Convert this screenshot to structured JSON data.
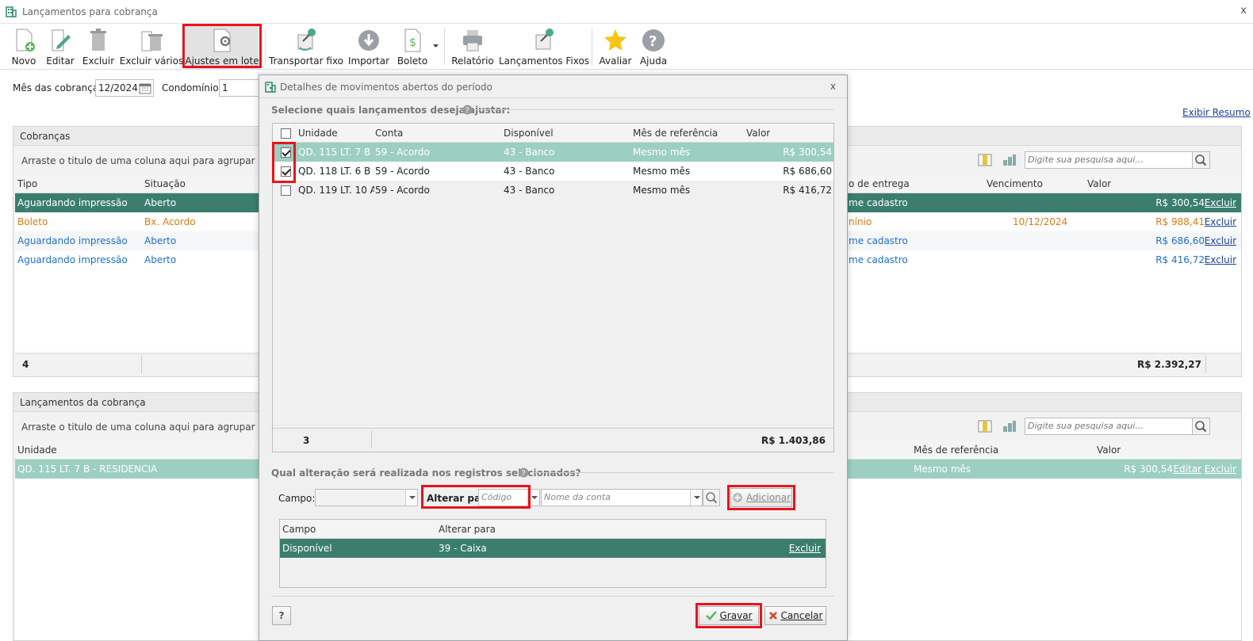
{
  "window": {
    "title": "Lançamentos para cobrança",
    "close": "x"
  },
  "toolbar": {
    "novo": "Novo",
    "editar": "Editar",
    "excluir": "Excluir",
    "excluir_varios": "Excluir vários",
    "ajustes": "Ajustes em lote",
    "transportar": "Transportar fixo",
    "importar": "Importar",
    "boleto": "Boleto",
    "relatorio": "Relatório",
    "lanc_fixos": "Lançamentos Fixos",
    "avaliar": "Avaliar",
    "ajuda": "Ajuda"
  },
  "filters": {
    "mes_label": "Mês das cobranças:",
    "mes_value": "12/2024",
    "cond_label": "Condomínio:",
    "cond_value": "1",
    "exibir_resumo": "Exibir Resumo"
  },
  "cobrancas": {
    "title": "Cobranças",
    "group_hint": "Arraste o titulo de uma coluna aqui para agrupar por essa",
    "search_placeholder": "Digite sua pesquisa aqui...",
    "cols": {
      "tipo": "Tipo",
      "situacao": "Situação",
      "entrega": "o de entrega",
      "vencimento": "Vencimento",
      "valor": "Valor"
    },
    "rows": [
      {
        "tipo": "Aguardando impressão",
        "situacao": "Aberto",
        "entrega": "me cadastro",
        "venc": "",
        "valor": "R$ 300,54",
        "acao": "Excluir"
      },
      {
        "tipo": "Boleto",
        "situacao": "Bx. Acordo",
        "entrega": "nínio",
        "venc": "10/12/2024",
        "valor": "R$ 988,41",
        "acao": "Excluir"
      },
      {
        "tipo": "Aguardando impressão",
        "situacao": "Aberto",
        "entrega": "me cadastro",
        "venc": "",
        "valor": "R$ 686,60",
        "acao": "Excluir"
      },
      {
        "tipo": "Aguardando impressão",
        "situacao": "Aberto",
        "entrega": "me cadastro",
        "venc": "",
        "valor": "R$ 416,72",
        "acao": "Excluir"
      }
    ],
    "count": "4",
    "total": "R$ 2.392,27"
  },
  "lancamentos": {
    "title": "Lançamentos da cobrança",
    "group_hint": "Arraste o titulo de uma coluna aqui para agrupar por essa",
    "search_placeholder": "Digite sua pesquisa aqui...",
    "cols": {
      "unidade": "Unidade",
      "mes_ref": "Mês de referência",
      "valor": "Valor"
    },
    "rows": [
      {
        "unidade": "QD. 115 LT. 7 B - RESIDENCIA",
        "mes_ref": "Mesmo mês",
        "valor": "R$ 300,54",
        "editar": "Editar",
        "excluir": "Excluir"
      }
    ]
  },
  "modal": {
    "title": "Detalhes de movimentos abertos do período",
    "close": "x",
    "section1": "Selecione quais lançamentos deseja ajustar:",
    "cols": {
      "unidade": "Unidade",
      "conta": "Conta",
      "disponivel": "Disponível",
      "mes_ref": "Mês de referência",
      "valor": "Valor"
    },
    "rows": [
      {
        "unidade": "QD. 115 LT. 7 B -...",
        "conta": "59 - Acordo",
        "disponivel": "43 - Banco",
        "mes_ref": "Mesmo mês",
        "valor": "R$ 300,54"
      },
      {
        "unidade": "QD. 118 LT. 6 B -...",
        "conta": "59 - Acordo",
        "disponivel": "43 - Banco",
        "mes_ref": "Mesmo mês",
        "valor": "R$ 686,60"
      },
      {
        "unidade": "QD. 119 LT. 10 A...",
        "conta": "59 - Acordo",
        "disponivel": "43 - Banco",
        "mes_ref": "Mesmo mês",
        "valor": "R$ 416,72"
      }
    ],
    "count": "3",
    "total": "R$ 1.403,86",
    "section2": "Qual alteração será realizada nos registros selecionados?",
    "campo_label": "Campo:",
    "alterar_label": "Alterar para:",
    "codigo_placeholder": "Código",
    "conta_placeholder": "Nome da conta",
    "adicionar": "Adicionar",
    "changes_cols": {
      "campo": "Campo",
      "alterar": "Alterar para"
    },
    "changes": [
      {
        "campo": "Disponível",
        "alterar": "39 - Caixa",
        "acao": "Excluir"
      }
    ],
    "help": "?",
    "gravar": "Gravar",
    "cancelar": "Cancelar"
  },
  "colors": {
    "accent": "#3b7e6e",
    "selected_light": "#9ccfc2",
    "link": "#1a3fa8",
    "orange": "#e07b0f",
    "blue_text": "#1f6fd1",
    "highlight": "#e8141c"
  }
}
